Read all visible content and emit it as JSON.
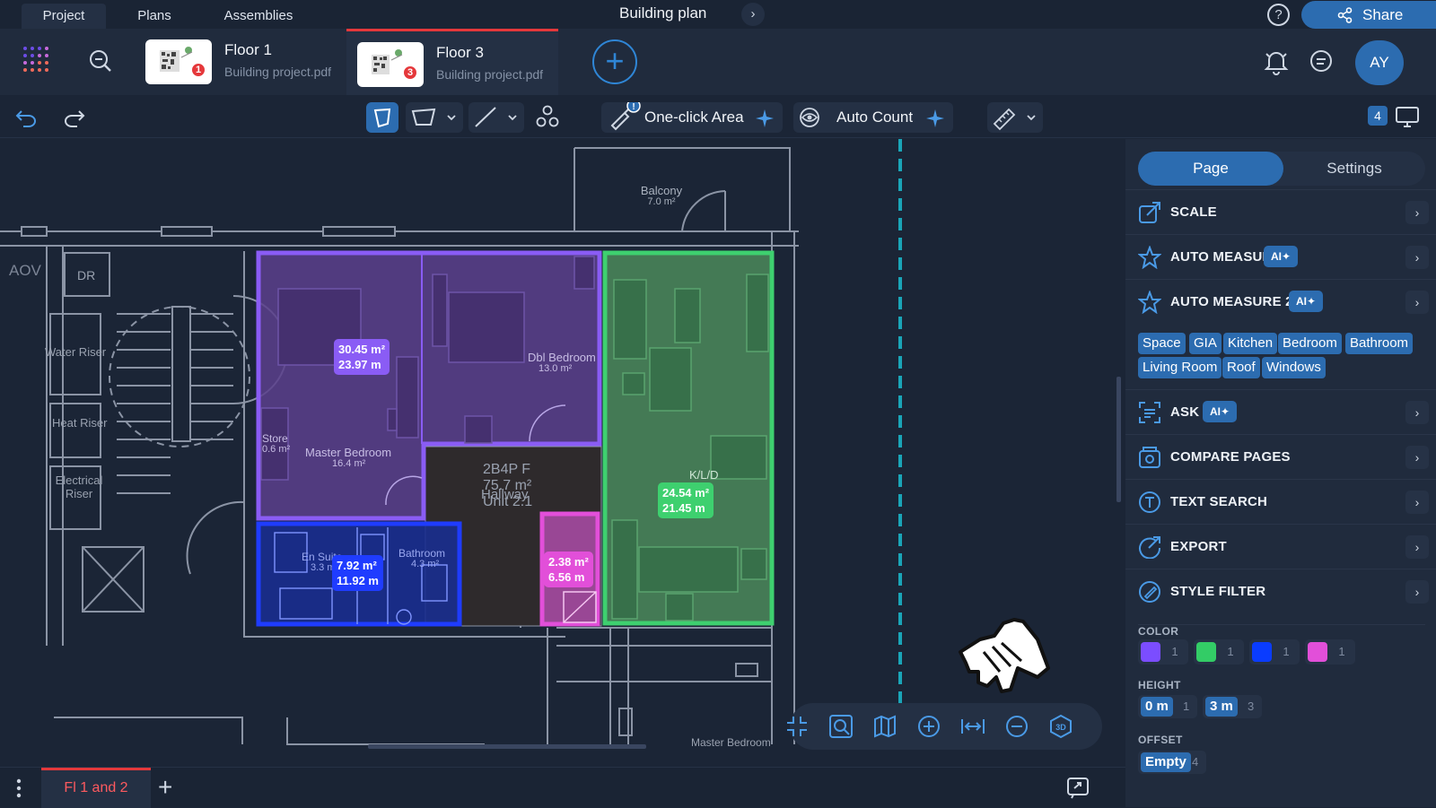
{
  "top_tabs": [
    "Project",
    "Plans",
    "Assemblies"
  ],
  "doc_title": "Building plan",
  "share_label": "Share",
  "files": [
    {
      "name": "Floor 1",
      "file": "Building project.pdf",
      "badge": "1"
    },
    {
      "name": "Floor 3",
      "file": "Building project.pdf",
      "badge": "3"
    }
  ],
  "avatar_initials": "AY",
  "toolbar": {
    "one_click_area": "One-click Area",
    "auto_count": "Auto Count",
    "page_count": "4"
  },
  "panel": {
    "tabs": [
      "Page",
      "Settings"
    ],
    "rows": [
      {
        "label": "SCALE",
        "ai": ""
      },
      {
        "label": "AUTO MEASURE",
        "ai": "AI"
      },
      {
        "label": "AUTO MEASURE 2.0",
        "ai": "AI"
      },
      {
        "label": "ASK AI",
        "ai": "AI"
      },
      {
        "label": "COMPARE PAGES",
        "ai": ""
      },
      {
        "label": "TEXT SEARCH",
        "ai": ""
      },
      {
        "label": "EXPORT",
        "ai": ""
      },
      {
        "label": "STYLE FILTER",
        "ai": ""
      }
    ],
    "chips": [
      "Space",
      "GIA",
      "Kitchen",
      "Bedroom",
      "Bathroom",
      "Living Room",
      "Roof",
      "Windows"
    ],
    "color_label": "COLOR",
    "colors": [
      {
        "hex": "#7b4dff",
        "count": "1"
      },
      {
        "hex": "#33cc66",
        "count": "1"
      },
      {
        "hex": "#0a3cff",
        "count": "1"
      },
      {
        "hex": "#e24fd9",
        "count": "1"
      }
    ],
    "height_label": "HEIGHT",
    "heights": [
      {
        "value": "0 m",
        "count": "1"
      },
      {
        "value": "3 m",
        "count": "3"
      }
    ],
    "offset_label": "OFFSET",
    "offsets": [
      {
        "value": "Empty",
        "count": "4"
      }
    ]
  },
  "plan": {
    "rooms": [
      {
        "name": "Balcony",
        "area": "7.0 m²"
      },
      {
        "name": "Dbl Bedroom",
        "area": "13.0 m²"
      },
      {
        "name": "Master Bedroom",
        "area": "16.4 m²"
      },
      {
        "name": "Store",
        "area": "0.6 m²"
      },
      {
        "name": "K/L/D",
        "area": ""
      },
      {
        "name": "En Suite",
        "area": "3.3 m²"
      },
      {
        "name": "Bathroom",
        "area": "4.3 m²"
      },
      {
        "name": "Hallway",
        "area": ""
      }
    ],
    "unit_type": "2B4P F",
    "unit_area": "75.7 m²",
    "unit_name": "Unit 2.1",
    "left_labels": [
      "AOV",
      "DR",
      "Water Riser",
      "Heat Riser",
      "Electrical Riser"
    ],
    "bottom_label": "Master Bedroom",
    "measurements": [
      {
        "area": "30.45 m²",
        "perimeter": "23.97 m",
        "color": "#8a5cf5"
      },
      {
        "area": "24.54 m²",
        "perimeter": "21.45 m",
        "color": "#3ed06f"
      },
      {
        "area": "7.92 m²",
        "perimeter": "11.92 m",
        "color": "#1f3cff"
      },
      {
        "area": "2.38 m²",
        "perimeter": "6.56 m",
        "color": "#e24fd9"
      }
    ]
  },
  "sheet_tab": "Fl 1 and 2"
}
